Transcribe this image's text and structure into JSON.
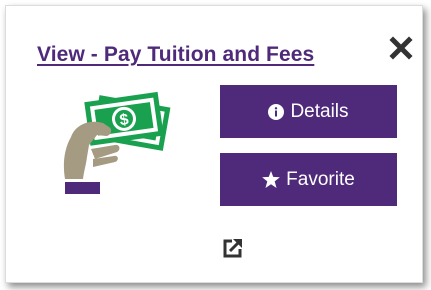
{
  "card": {
    "title": "View - Pay Tuition and Fees",
    "colors": {
      "accent": "#4f2a7a",
      "money_green": "#1aa150",
      "hand": "#a59a82",
      "icon_dark": "#333333"
    },
    "icons": {
      "close": "close-icon",
      "illustration": "hand-holding-money-icon",
      "details": "info-circle-icon",
      "favorite": "star-icon",
      "external": "external-link-icon"
    },
    "buttons": {
      "details_label": "Details",
      "favorite_label": "Favorite"
    }
  }
}
